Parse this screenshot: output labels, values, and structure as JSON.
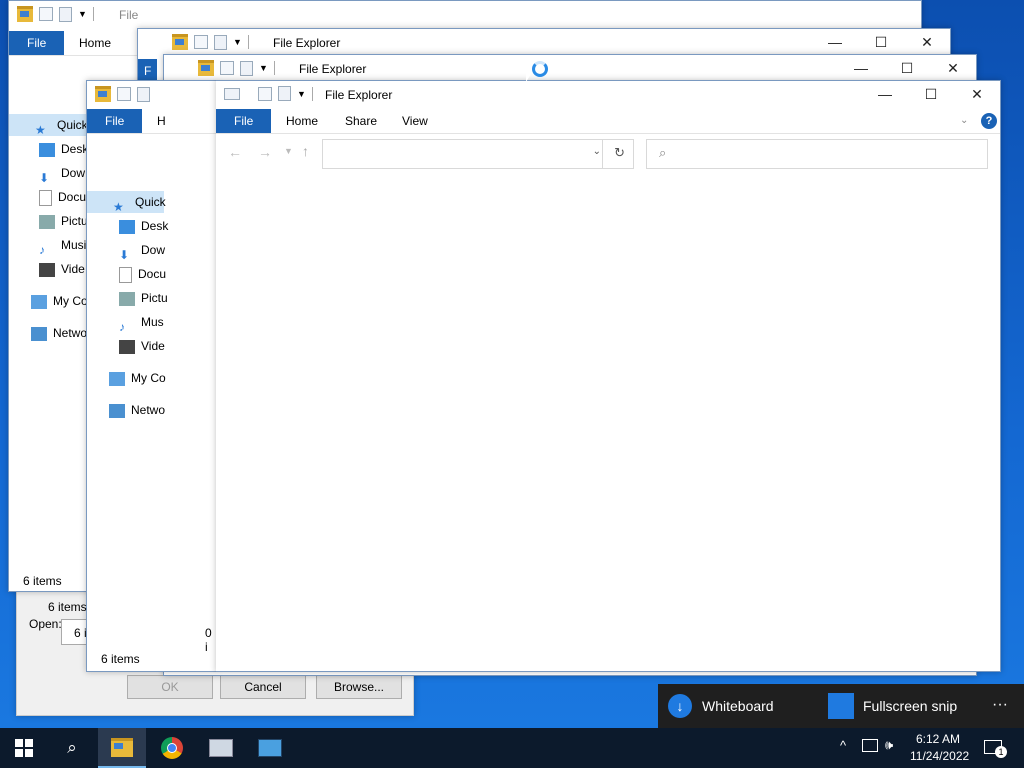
{
  "window": {
    "title": "File Explorer",
    "title_short": "File",
    "minimize": "—",
    "maximize": "☐",
    "close": "✕"
  },
  "ribbon": {
    "file": "File",
    "home": "Home",
    "home_short": "H",
    "share": "Share",
    "view": "View",
    "help": "?"
  },
  "nav": {
    "quick_access": "Quick",
    "desktop": "Desk",
    "downloads": "Dow",
    "documents": "Docu",
    "pictures": "Pictu",
    "music": "Mus",
    "videos": "Vide",
    "computer": "My Co",
    "network": "Netwo",
    "back_window": {
      "desktop": "Desk",
      "downloads": "Dow",
      "documents": "Docu",
      "pictures": "Pictu",
      "music": "Musi",
      "videos": "Vide",
      "computer": "My Co",
      "network": "Netwo",
      "quick": "Quick",
      "file_short": "F"
    }
  },
  "status": {
    "items": "6 items",
    "items_short": "6 i",
    "zero": "0 i"
  },
  "dialog": {
    "open_label": "Open:",
    "ok": "OK",
    "cancel": "Cancel",
    "browse": "Browse..."
  },
  "snip": {
    "whiteboard": "Whiteboard",
    "fullscreen": "Fullscreen snip",
    "more": "···"
  },
  "tray": {
    "time": "6:12 AM",
    "date": "11/24/2022",
    "notif_count": "1"
  },
  "colors": {
    "accent": "#1a62b5",
    "taskbar": "#0c1a2c"
  }
}
